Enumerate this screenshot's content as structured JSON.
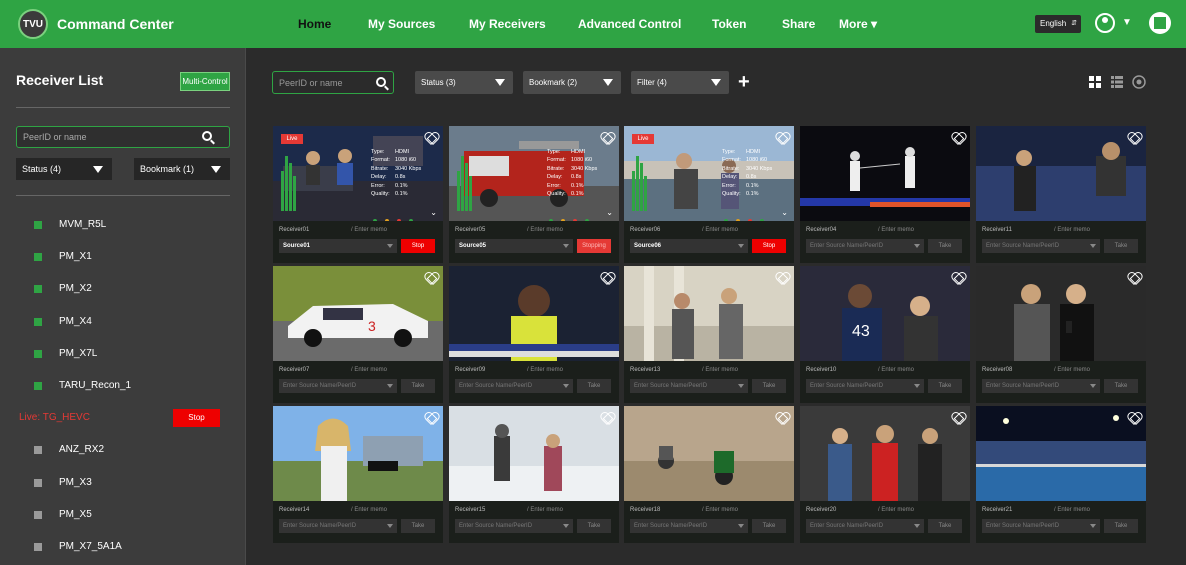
{
  "topbar": {
    "logo_text": "TVU",
    "title": "Command Center",
    "nav": [
      "Home",
      "My Sources",
      "My Receivers",
      "Advanced Control",
      "Token",
      "Share",
      "More ▾"
    ],
    "active_nav": "Home",
    "language": "English",
    "brand_color": "#2fa444"
  },
  "sidebar": {
    "title": "Receiver List",
    "multi_control_label": "Multi-Control",
    "search_placeholder": "PeerID or name",
    "status_filter": "Status (4)",
    "bookmark_filter": "Bookmark (1)",
    "receivers": [
      {
        "label": "MVM_R5L",
        "state": "online"
      },
      {
        "label": "PM_X1",
        "state": "online"
      },
      {
        "label": "PM_X2",
        "state": "online"
      },
      {
        "label": "PM_X4",
        "state": "online"
      },
      {
        "label": "PM_X7L",
        "state": "online"
      },
      {
        "label": "TARU_Recon_1",
        "state": "online"
      },
      {
        "label": "Live: TG_HEVC",
        "state": "live",
        "action": "Stop"
      },
      {
        "label": "ANZ_RX2",
        "state": "offline"
      },
      {
        "label": "PM_X3",
        "state": "offline"
      },
      {
        "label": "PM_X5",
        "state": "offline"
      },
      {
        "label": "PM_X7_5A1A",
        "state": "offline"
      }
    ]
  },
  "toolbar": {
    "search_placeholder": "PeerID or name",
    "status": "Status (3)",
    "bookmark": "Bookmark (2)",
    "filter": "Filter (4)",
    "add_label": "+"
  },
  "info_keys": [
    "Type:",
    "Format:",
    "Bitrate:",
    "Delay:",
    "Error:",
    "Quality:"
  ],
  "memo_placeholder": "/ Enter memo",
  "source_placeholder": "Enter Source Name/PeerID",
  "cards": [
    {
      "name": "Receiver01",
      "live": true,
      "source": "Source01",
      "action": "Stop",
      "info": [
        "HDMI",
        "1080 i60",
        "3040 Kbps",
        "0.8s",
        "0.1%",
        "0.1%"
      ],
      "scene": "studio"
    },
    {
      "name": "Receiver05",
      "live": false,
      "source": "Source05",
      "action": "Stopping",
      "info": [
        "HDMI",
        "1080 i60",
        "3040 Kbps",
        "0.8s",
        "0.1%",
        "0.1%"
      ],
      "scene": "firetruck"
    },
    {
      "name": "Receiver06",
      "live": true,
      "source": "Source06",
      "action": "Stop",
      "info": [
        "HDMI",
        "1080 i60",
        "3040 Kbps",
        "0.8s",
        "0.1%",
        "0.1%"
      ],
      "scene": "harbor"
    },
    {
      "name": "Receiver04",
      "live": false,
      "source": "",
      "action": "Take",
      "scene": "fencing"
    },
    {
      "name": "Receiver11",
      "live": false,
      "source": "",
      "action": "Take",
      "scene": "arena"
    },
    {
      "name": "Receiver07",
      "live": false,
      "source": "",
      "action": "Take",
      "scene": "racecar"
    },
    {
      "name": "Receiver09",
      "live": false,
      "source": "",
      "action": "Take",
      "scene": "reporter"
    },
    {
      "name": "Receiver13",
      "live": false,
      "source": "",
      "action": "Take",
      "scene": "interview"
    },
    {
      "name": "Receiver10",
      "live": false,
      "source": "",
      "action": "Take",
      "scene": "football"
    },
    {
      "name": "Receiver08",
      "live": false,
      "source": "",
      "action": "Take",
      "scene": "fitness"
    },
    {
      "name": "Receiver14",
      "live": false,
      "source": "",
      "action": "Take",
      "scene": "outdoor"
    },
    {
      "name": "Receiver15",
      "live": false,
      "source": "",
      "action": "Take",
      "scene": "snow"
    },
    {
      "name": "Receiver18",
      "live": false,
      "source": "",
      "action": "Take",
      "scene": "motocross"
    },
    {
      "name": "Receiver20",
      "live": false,
      "source": "",
      "action": "Take",
      "scene": "athletes"
    },
    {
      "name": "Receiver21",
      "live": false,
      "source": "",
      "action": "Take",
      "scene": "stadium"
    }
  ],
  "icons": {
    "search": "search-icon",
    "heart": "heart-icon",
    "grid": "grid-view-icon",
    "list": "list-view-icon",
    "map": "map-pin-icon",
    "apps": "apps-icon",
    "user": "user-avatar-icon"
  }
}
